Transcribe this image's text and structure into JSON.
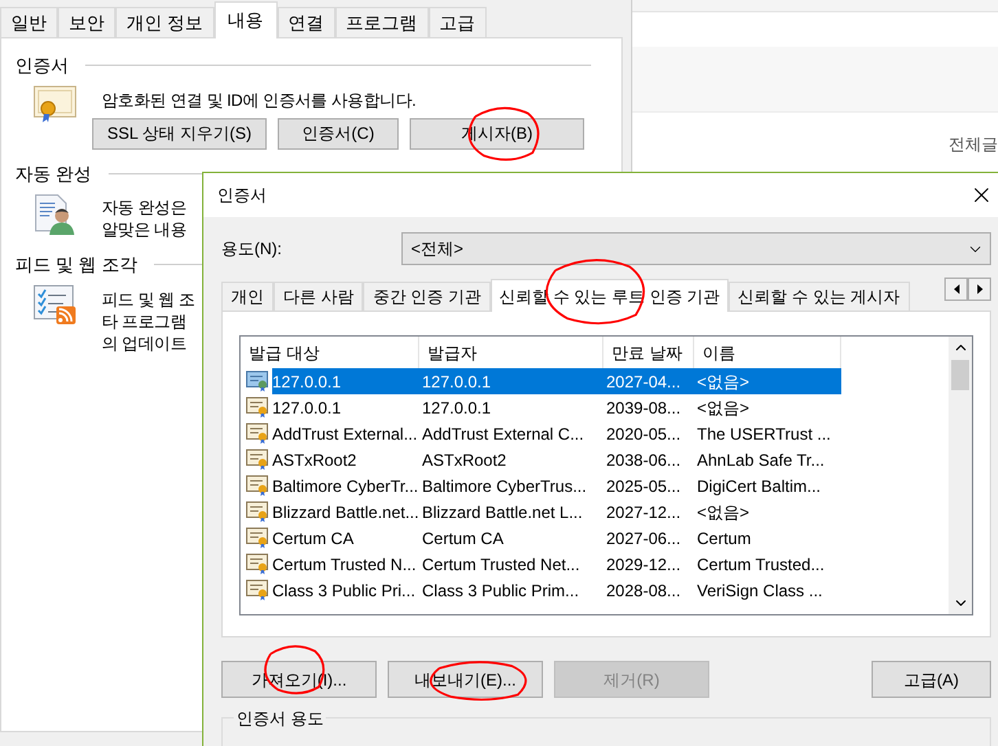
{
  "background_window": {
    "tabs": [
      {
        "label": "일반",
        "selected": false
      },
      {
        "label": "보안",
        "selected": false
      },
      {
        "label": "개인 정보",
        "selected": false
      },
      {
        "label": "내용",
        "selected": true
      },
      {
        "label": "연결",
        "selected": false
      },
      {
        "label": "프로그램",
        "selected": false
      },
      {
        "label": "고급",
        "selected": false
      }
    ],
    "sections": [
      {
        "kind": "certificate",
        "title": "인증서",
        "lines": [
          "암호화된 연결 및 ID에 인증서를 사용합니다."
        ],
        "buttons": [
          "SSL 상태 지우기(S)",
          "인증서(C)",
          "게시자(B)"
        ]
      },
      {
        "kind": "autocomplete",
        "title": "자동 완성",
        "lines": [
          "자동 완성은",
          "알맞은 내용"
        ]
      },
      {
        "kind": "feeds",
        "title": "피드 및 웹 조각",
        "lines": [
          "피드 및 웹 조",
          "타 프로그램",
          "의 업데이트"
        ]
      }
    ]
  },
  "browser_page": {
    "text": "전체글"
  },
  "dialog": {
    "title": "인증서",
    "purpose_label": "용도(N):",
    "purpose_value": "<전체>",
    "tabs": [
      {
        "label": "개인",
        "selected": false
      },
      {
        "label": "다른 사람",
        "selected": false
      },
      {
        "label": "중간 인증 기관",
        "selected": false
      },
      {
        "label": "신뢰할 수 있는 루트 인증 기관",
        "selected": true
      },
      {
        "label": "신뢰할 수 있는 게시자",
        "selected": false
      }
    ],
    "columns": [
      "발급 대상",
      "발급자",
      "만료 날짜",
      "이름"
    ],
    "rows": [
      {
        "cells": [
          "127.0.0.1",
          "127.0.0.1",
          "2027-04...",
          "<없음>"
        ],
        "selected": true
      },
      {
        "cells": [
          "127.0.0.1",
          "127.0.0.1",
          "2039-08...",
          "<없음>"
        ],
        "selected": false
      },
      {
        "cells": [
          "AddTrust External...",
          "AddTrust External C...",
          "2020-05...",
          "The USERTrust ..."
        ],
        "selected": false
      },
      {
        "cells": [
          "ASTxRoot2",
          "ASTxRoot2",
          "2038-06...",
          "AhnLab Safe Tr..."
        ],
        "selected": false
      },
      {
        "cells": [
          "Baltimore CyberTr...",
          "Baltimore CyberTrus...",
          "2025-05...",
          "DigiCert Baltim..."
        ],
        "selected": false
      },
      {
        "cells": [
          "Blizzard Battle.net...",
          "Blizzard Battle.net L...",
          "2027-12...",
          "<없음>"
        ],
        "selected": false
      },
      {
        "cells": [
          "Certum CA",
          "Certum CA",
          "2027-06...",
          "Certum"
        ],
        "selected": false
      },
      {
        "cells": [
          "Certum Trusted N...",
          "Certum Trusted Net...",
          "2029-12...",
          "Certum Trusted..."
        ],
        "selected": false
      },
      {
        "cells": [
          "Class 3 Public Pri...",
          "Class 3 Public Prim...",
          "2028-08...",
          "VeriSign Class ..."
        ],
        "selected": false
      }
    ],
    "buttons": [
      {
        "label": "가져오기(I)...",
        "disabled": false
      },
      {
        "label": "내보내기(E)...",
        "disabled": false
      },
      {
        "label": "제거(R)",
        "disabled": true
      },
      {
        "label": "고급(A)",
        "disabled": false
      }
    ],
    "group_label": "인증서 용도"
  }
}
